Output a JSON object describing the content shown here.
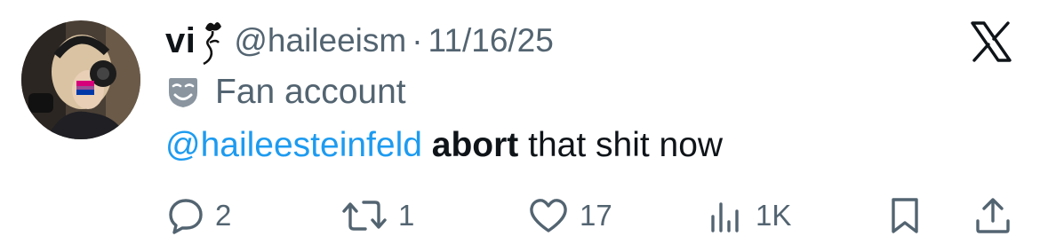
{
  "tweet": {
    "display_name": "vi",
    "name_emoji": "rose-emoji",
    "handle": "@haileeism",
    "separator": "·",
    "date": "11/16/25",
    "label_icon": "performing-arts-masks-icon",
    "label": "Fan account",
    "text": {
      "mention": "@haileesteinfeld",
      "bold": "abort",
      "rest": " that shit now"
    }
  },
  "logo": "x-logo",
  "actions": {
    "replies": "2",
    "reposts": "1",
    "likes": "17",
    "views": "1K"
  },
  "colors": {
    "text": "#0f1419",
    "secondary": "#536471",
    "mention": "#1d9bf0"
  }
}
